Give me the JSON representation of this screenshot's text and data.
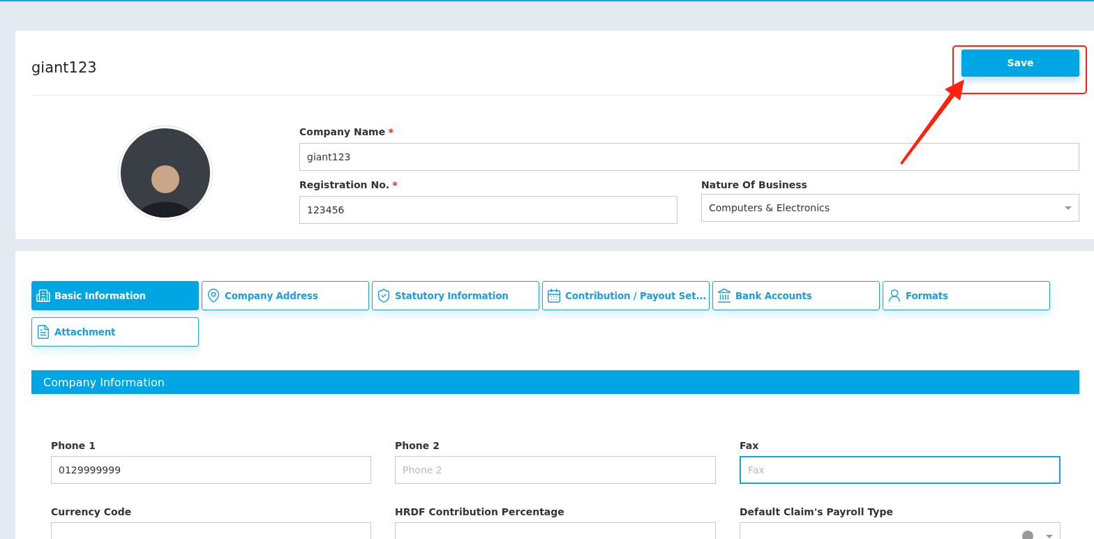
{
  "header": {
    "title": "giant123",
    "save_button": "Save",
    "fields": [
      {
        "label": "Company Name",
        "required_mark": "*",
        "value": "giant123",
        "kind": "text"
      },
      {
        "label": "Registration No.",
        "required_mark": "*",
        "value": "123456",
        "kind": "text"
      },
      {
        "label": "Nature Of Business",
        "value": "Computers & Electronics",
        "kind": "select"
      }
    ]
  },
  "tabs": [
    {
      "label": "Basic Information",
      "selected": true
    },
    {
      "label": "Company Address",
      "selected": false
    },
    {
      "label": "Statutory Information",
      "selected": false
    },
    {
      "label": "Contribution / Payout Set...",
      "selected": false
    },
    {
      "label": "Bank Accounts",
      "selected": false
    },
    {
      "label": "Formats",
      "selected": false
    },
    {
      "label": "Attachment",
      "selected": false
    }
  ],
  "section": {
    "title": "Company Information"
  },
  "form_fields": [
    {
      "label": "Phone 1",
      "value": "0129999999",
      "kind": "text",
      "focused": false
    },
    {
      "label": "Phone 2",
      "placeholder": "Phone 2",
      "kind": "text",
      "focused": false
    },
    {
      "label": "Fax",
      "placeholder": "Fax",
      "kind": "text",
      "focused": true
    },
    {
      "label": "Currency Code",
      "kind": "text",
      "focused": false
    },
    {
      "label": "HRDF Contribution Percentage",
      "kind": "text",
      "focused": false
    },
    {
      "label": "Default Claim's Payroll Type",
      "kind": "select_clearable",
      "focused": false
    }
  ]
}
